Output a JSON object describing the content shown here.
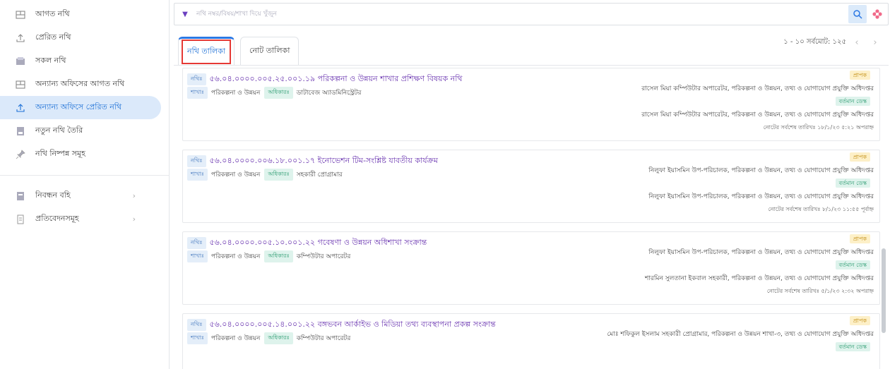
{
  "sidebar": {
    "items": [
      {
        "label": "আগত নথি",
        "icon": "inbox-icon"
      },
      {
        "label": "প্রেরিত নথি",
        "icon": "upload-icon"
      },
      {
        "label": "সকল নথি",
        "icon": "folder-icon"
      },
      {
        "label": "অন্যান্য অফিসের আগত নথি",
        "icon": "inbox-icon"
      },
      {
        "label": "অন্যান্য অফিসে প্রেরিত নথি",
        "icon": "upload-icon"
      },
      {
        "label": "নতুন নথি তৈরি",
        "icon": "new-document-icon"
      },
      {
        "label": "নথি নিষ্পন্ন সমূহ",
        "icon": "pin-icon"
      }
    ],
    "items2": [
      {
        "label": "নিবন্ধন বহি",
        "icon": "register-icon"
      },
      {
        "label": "প্রতিবেদনসমূহ",
        "icon": "report-icon"
      }
    ]
  },
  "search": {
    "placeholder": "নথি নম্বর/বিষয়/শাখা দিয়ে খুঁজুন"
  },
  "tabs": [
    {
      "label": "নথি তালিকা"
    },
    {
      "label": "নোট তালিকা"
    }
  ],
  "pager": {
    "text": "১ - ১০ সর্বমোট: ১২৫"
  },
  "labels": {
    "nothi": "নথিঃ",
    "shakha": "শাখাঃ",
    "odhikari": "অধিকারঃ",
    "prapok": "প্রাপক",
    "desk": "বর্তমান ডেস্ক"
  },
  "cards": [
    {
      "id": "৫৬.০৪.০০০০.০০৫.২৫.০০১.১৯ পরিকল্পনা ও উন্নয়ন শাখার প্রশিক্ষণ বিষয়ক নথি",
      "shakha": "পরিকল্পনা ও উন্নয়ন",
      "odhikari": "ডাটাবেজ অ্যাডমিনিস্ট্রেটর",
      "prapok": "রাসেল মিয়া কম্পিউটার অপারেটর, পরিকল্পনা ও উন্নয়ন, তথ্য ও যোগাযোগ প্রযুক্তি অধিদপ্তর",
      "desk": "রাসেল মিয়া কম্পিউটার অপারেটর, পরিকল্পনা ও উন্নয়ন, তথ্য ও যোগাযোগ প্রযুক্তি অধিদপ্তর",
      "date": "নোটের সর্বশেষ তারিখঃ ১৮/১/২৩ ৫:২১ অপরাহ্ন"
    },
    {
      "id": "৫৬.০৪.০০০০.০০৬.১৮.০০১.১৭ ইনোভেশন টিম-সংশ্লিষ্ট যাবতীয় কার্যক্রম",
      "shakha": "পরিকল্পনা ও উন্নয়ন",
      "odhikari": "সহকারী প্রোগ্রামার",
      "prapok": "নিলুফা ইয়াসমিন উপ-পরিচালক, পরিকল্পনা ও উন্নয়ন, তথ্য ও যোগাযোগ প্রযুক্তি অধিদপ্তর",
      "desk": "নিলুফা ইয়াসমিন উপ-পরিচালক, পরিকল্পনা ও উন্নয়ন, তথ্য ও যোগাযোগ প্রযুক্তি অধিদপ্তর",
      "date": "নোটের সর্বশেষ তারিখঃ ৮/১/২৩ ১১:৫৫ পূর্বাহ্ন"
    },
    {
      "id": "৫৬.০৪.০০০০.০০৫.১০.০০১.২২ গবেষণা ও উন্নয়ন অধিশাখা সংক্রান্ত",
      "shakha": "পরিকল্পনা ও উন্নয়ন",
      "odhikari": "কম্পিউটার অপারেটর",
      "prapok": "নিলুফা ইয়াসমিন উপ-পরিচালক, পরিকল্পনা ও উন্নয়ন, তথ্য ও যোগাযোগ প্রযুক্তি অধিদপ্তর",
      "desk": "শারমিন সুলতানা ইকবাল সহকারী, পরিকল্পনা ও উন্নয়ন, তথ্য ও যোগাযোগ প্রযুক্তি অধিদপ্তর",
      "date": "নোটের সর্বশেষ তারিখঃ ৫/১/২৩ ২:৩২ অপরাহ্ন"
    },
    {
      "id": "৫৬.০৪.০০০০.০০৫.১৪.০০১.২২ বঙ্গভবন আর্কাইভ ও মিডিয়া তথ্য ব্যবস্থাপনা প্রকল্প সংক্রান্ত",
      "shakha": "পরিকল্পনা ও উন্নয়ন",
      "odhikari": "কম্পিউটার অপারেটর",
      "prapok": "মোঃ শফিকুল ইসলাম সহকারী প্রোগ্রামার, পরিকল্পনা ও উন্নয়ন শাখা-৩, তথ্য ও যোগাযোগ প্রযুক্তি অধিদপ্তর",
      "desk": "",
      "date": ""
    }
  ]
}
